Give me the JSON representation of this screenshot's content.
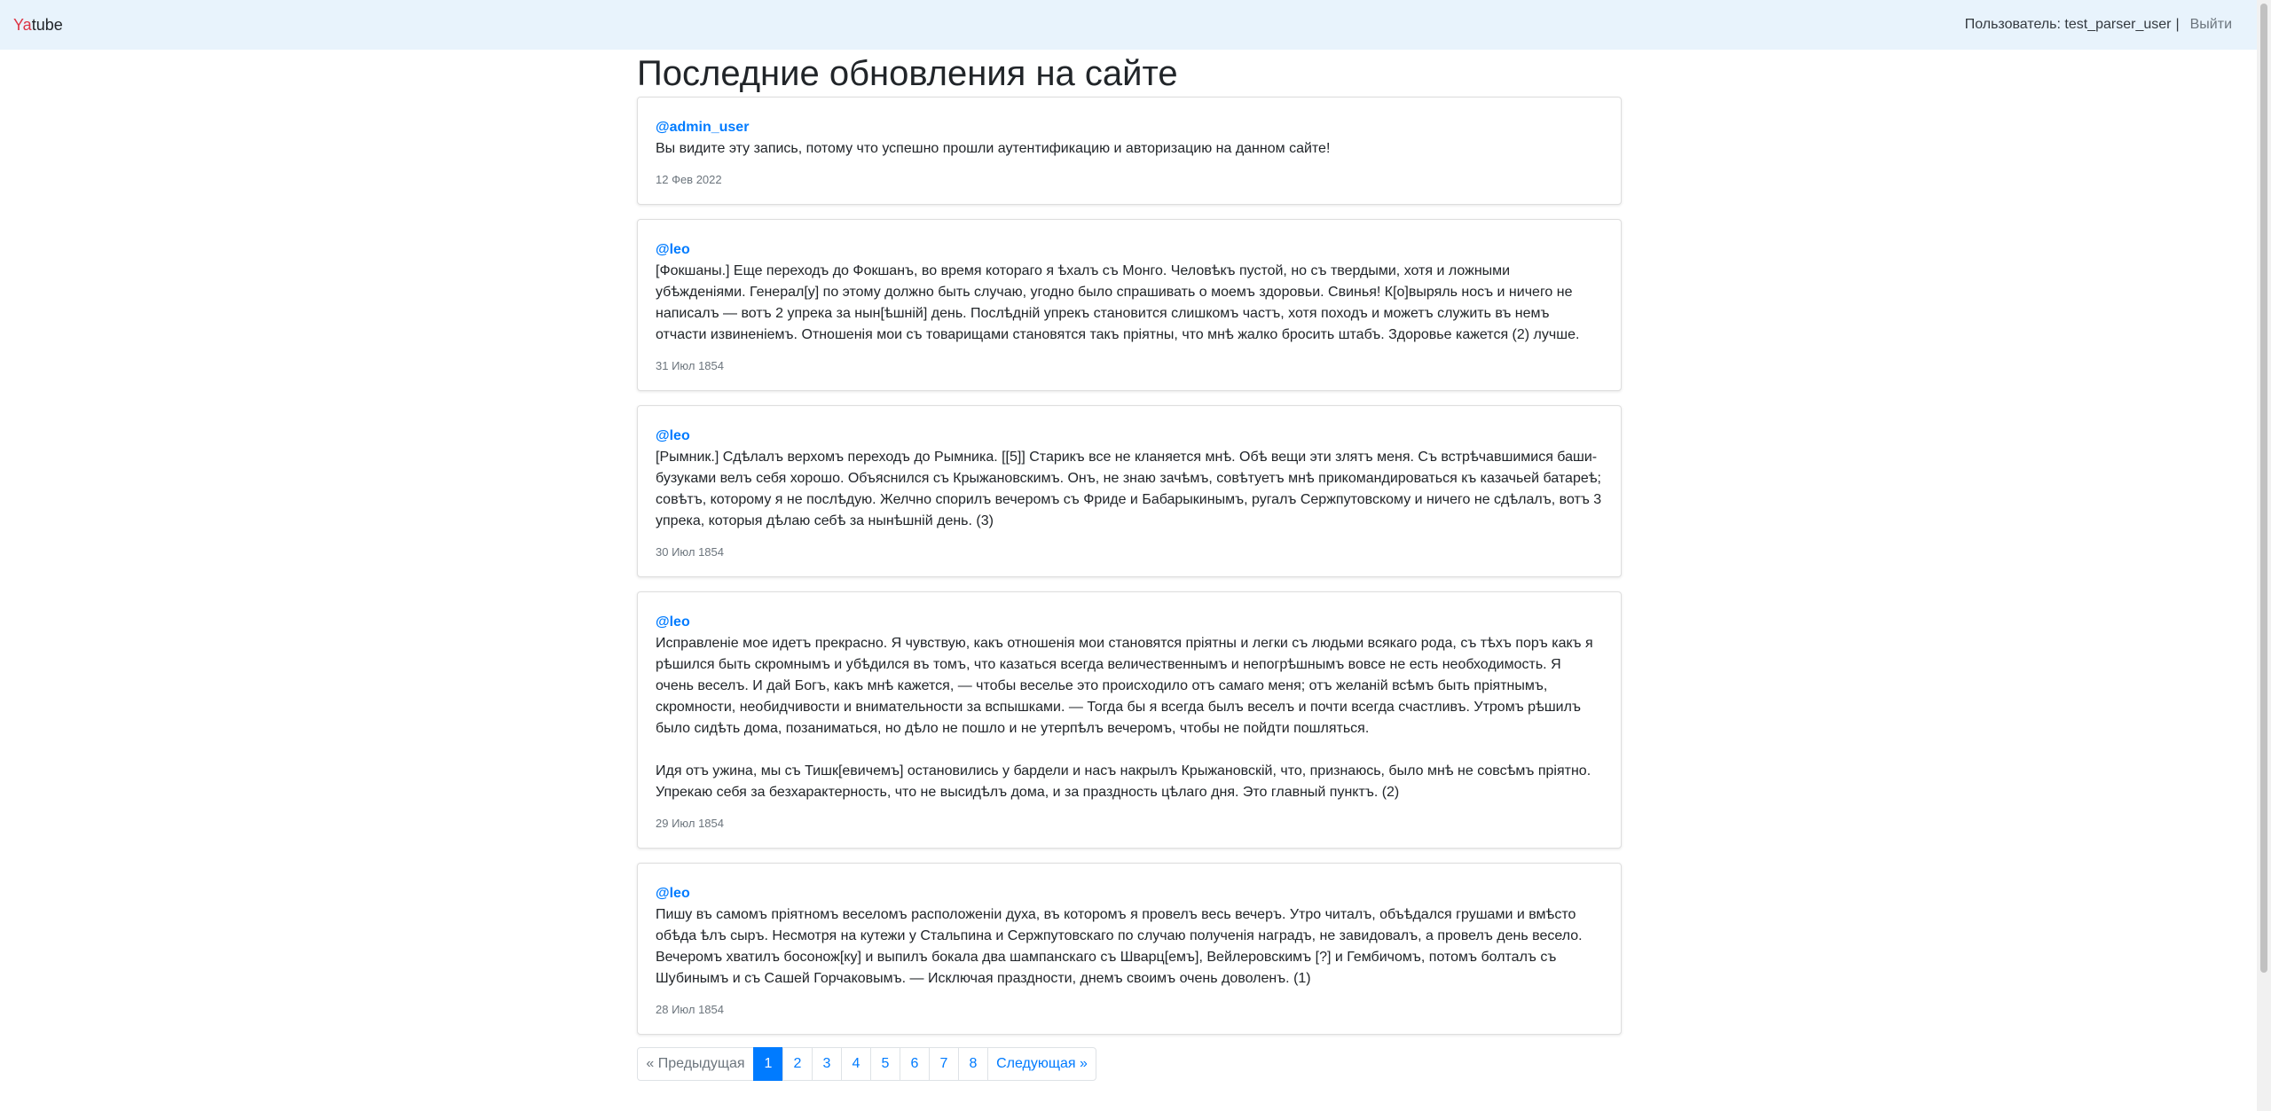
{
  "navbar": {
    "brand_first": "Ya",
    "brand_rest": "tube",
    "user_text": "Пользователь: test_parser_user",
    "separator": "|",
    "logout": "Выйти"
  },
  "page_title": "Последние обновления на сайте",
  "posts": [
    {
      "author": "@admin_user",
      "paragraphs": [
        "Вы видите эту запись, потому что успешно прошли аутентификацию и авторизацию на данном сайте!"
      ],
      "date": "12 Фев 2022"
    },
    {
      "author": "@leo",
      "paragraphs": [
        "[Фокшаны.] Еще переходъ до Фокшанъ, во время котораго я ѣхалъ съ Монго. Человѣкъ пустой, но съ твердыми, хотя и ложными убѣжденіями. Генерал[у] по этому должно быть случаю, угодно было спрашивать о моемъ здоровьи. Свинья! К[о]выряль носъ и ничего не написалъ — вотъ 2 упрека за нын[ѣшній] день. Послѣдній упрекъ становится слишкомъ частъ, хотя походъ и можетъ служить въ немъ отчасти извиненіемъ. Отношенія мои съ товарищами становятся такъ пріятны, что мнѣ жалко бросить штабъ. Здоровье кажется (2) лучше."
      ],
      "date": "31 Июл 1854"
    },
    {
      "author": "@leo",
      "paragraphs": [
        "[Рымник.] Сдѣлалъ верхомъ переходъ до Рымника. [[5]] Старикъ все не кланяется мнѣ. Обѣ вещи эти злятъ меня. Съ встрѣчавшимися баши-бузуками велъ себя хорошо. Объяснился съ Крыжановскимъ. Онъ, не знаю зачѣмъ, совѣтуетъ мнѣ прикомандироваться къ казачьей батареѣ; совѣтъ, которому я не послѣдую. Желчно спорилъ вечеромъ съ Фриде и Бабарыкинымъ, ругалъ Сержпутовскому и ничего не сдѣлалъ, вотъ 3 упрека, которыя дѣлаю себѣ за нынѣшній день. (3)"
      ],
      "date": "30 Июл 1854"
    },
    {
      "author": "@leo",
      "paragraphs": [
        "Исправленіе мое идетъ прекрасно. Я чувствую, какъ отношенія мои становятся пріятны и легки съ людьми всякаго рода, съ тѣхъ поръ какъ я рѣшился быть скромнымъ и убѣдился въ томъ, что казаться всегда величественнымъ и непогрѣшнымъ вовсе не есть необходимость. Я очень веселъ. И дай Богъ, какъ мнѣ кажется, — чтобы веселье это происходило отъ самаго меня; отъ желаній всѣмъ быть пріятнымъ, скромности, необидчивости и внимательности за вспышками. — Тогда бы я всегда былъ веселъ и почти всегда счастливъ. Утромъ рѣшилъ было сидѣть дома, позаниматься, но дѣло не пошло и не утерпѣлъ вечеромъ, чтобы не пойдти пошляться.",
        "Идя отъ ужина, мы съ Тишк[евичемъ] остановились у бардели и насъ накрылъ Крыжановскій, что, признаюсь, было мнѣ не совсѣмъ пріятно. Упрекаю себя за безхарактерность, что не высидѣлъ дома, и за праздность цѣлаго дня. Это главный пунктъ. (2)"
      ],
      "date": "29 Июл 1854"
    },
    {
      "author": "@leo",
      "paragraphs": [
        "Пишу въ самомъ пріятномъ веселомъ расположеніи духа, въ которомъ я провелъ весь вечеръ. Утро читалъ, объѣдался грушами и вмѣсто обѣда ѣлъ сыръ. Несмотря на кутежи у Стальпина и Сержпутовскаго по случаю полученія наградъ, не завидовалъ, а провелъ день весело. Вечеромъ хватилъ босонож[ку] и выпилъ бокала два шампанскаго съ Шварц[емъ], Вейлеровскимъ [?] и Гембичомъ, потомъ болталъ съ Шубинымъ и съ Сашей Горчаковымъ. — Исключая праздности, днемъ своимъ очень доволенъ. (1)"
      ],
      "date": "28 Июл 1854"
    }
  ],
  "pagination": {
    "prev": "« Предыдущая",
    "pages": [
      "1",
      "2",
      "3",
      "4",
      "5",
      "6",
      "7",
      "8"
    ],
    "active_page": "1",
    "next": "Следующая »"
  },
  "colors": {
    "navbar_bg": "#e8f3fc",
    "brand_accent": "#dc3545",
    "link": "#007bff",
    "muted": "#6c757d"
  }
}
